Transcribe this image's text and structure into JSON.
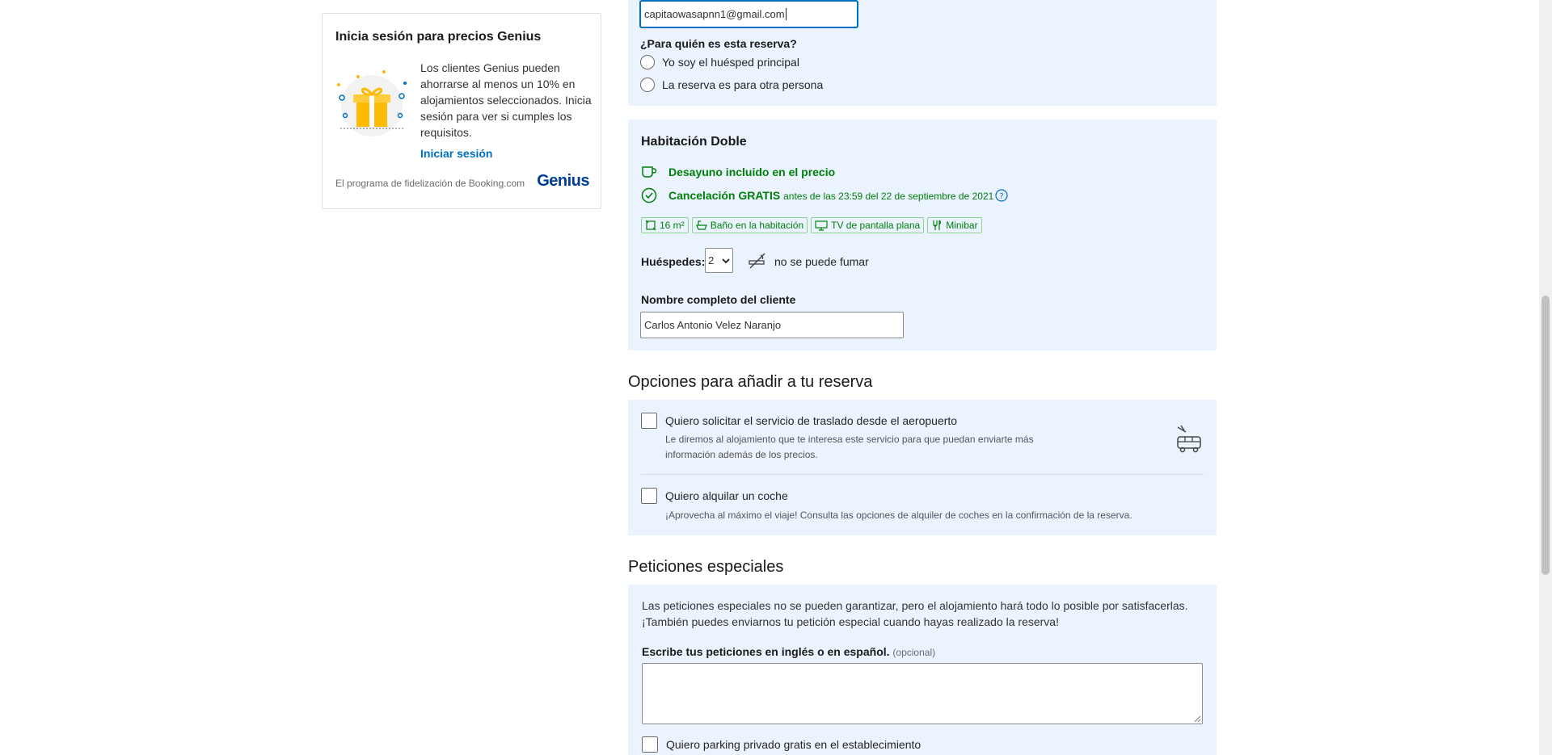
{
  "genius": {
    "title": "Inicia sesión para precios Genius",
    "description": "Los clientes Genius pueden ahorrarse al menos un 10% en alojamientos seleccionados. Inicia sesión para ver si cumples los requisitos.",
    "signin_link": "Iniciar sesión",
    "footer": "El programa de fidelización de Booking.com",
    "logo": "Genius"
  },
  "booking_for": {
    "email_value": "capitaowasapnn1@gmail.com",
    "question": "¿Para quién es esta reserva?",
    "options": [
      "Yo soy el huésped principal",
      "La reserva es para otra persona"
    ]
  },
  "room": {
    "title": "Habitación Doble",
    "breakfast": "Desayuno incluido en el precio",
    "cancel_bold": "Cancelación GRATIS",
    "cancel_rest": "antes de las 23:59 del 22 de septiembre de 2021",
    "facilities": [
      "16 m²",
      "Baño en la habitación",
      "TV de pantalla plana",
      "Minibar"
    ],
    "guests_label": "Huéspedes:",
    "guests_value": "2",
    "smoking": "no se puede fumar",
    "guest_name_label": "Nombre completo del cliente",
    "guest_name_value": "Carlos Antonio Velez Naranjo"
  },
  "addons": {
    "heading": "Opciones para añadir a tu reserva",
    "shuttle_label": "Quiero solicitar el servicio de traslado desde el aeropuerto",
    "shuttle_desc": "Le diremos al alojamiento que te interesa este servicio para que puedan enviarte más información además de los precios.",
    "car_label": "Quiero alquilar un coche",
    "car_desc": "¡Aprovecha al máximo el viaje! Consulta las opciones de alquiler de coches en la confirmación de la reserva."
  },
  "special": {
    "heading": "Peticiones especiales",
    "line1": "Las peticiones especiales no se pueden garantizar, pero el alojamiento hará todo lo posible por satisfacerlas.",
    "line2": "¡También puedes enviarnos tu petición especial cuando hayas realizado la reserva!",
    "textarea_label": "Escribe tus peticiones en inglés o en español.",
    "optional": "(opcional)",
    "parking_label": "Quiero parking privado gratis en el establecimiento"
  },
  "colors": {
    "accent": "#0071c2",
    "green": "#008009",
    "panel": "#ebf3ff",
    "genius_blue": "#003b95"
  }
}
